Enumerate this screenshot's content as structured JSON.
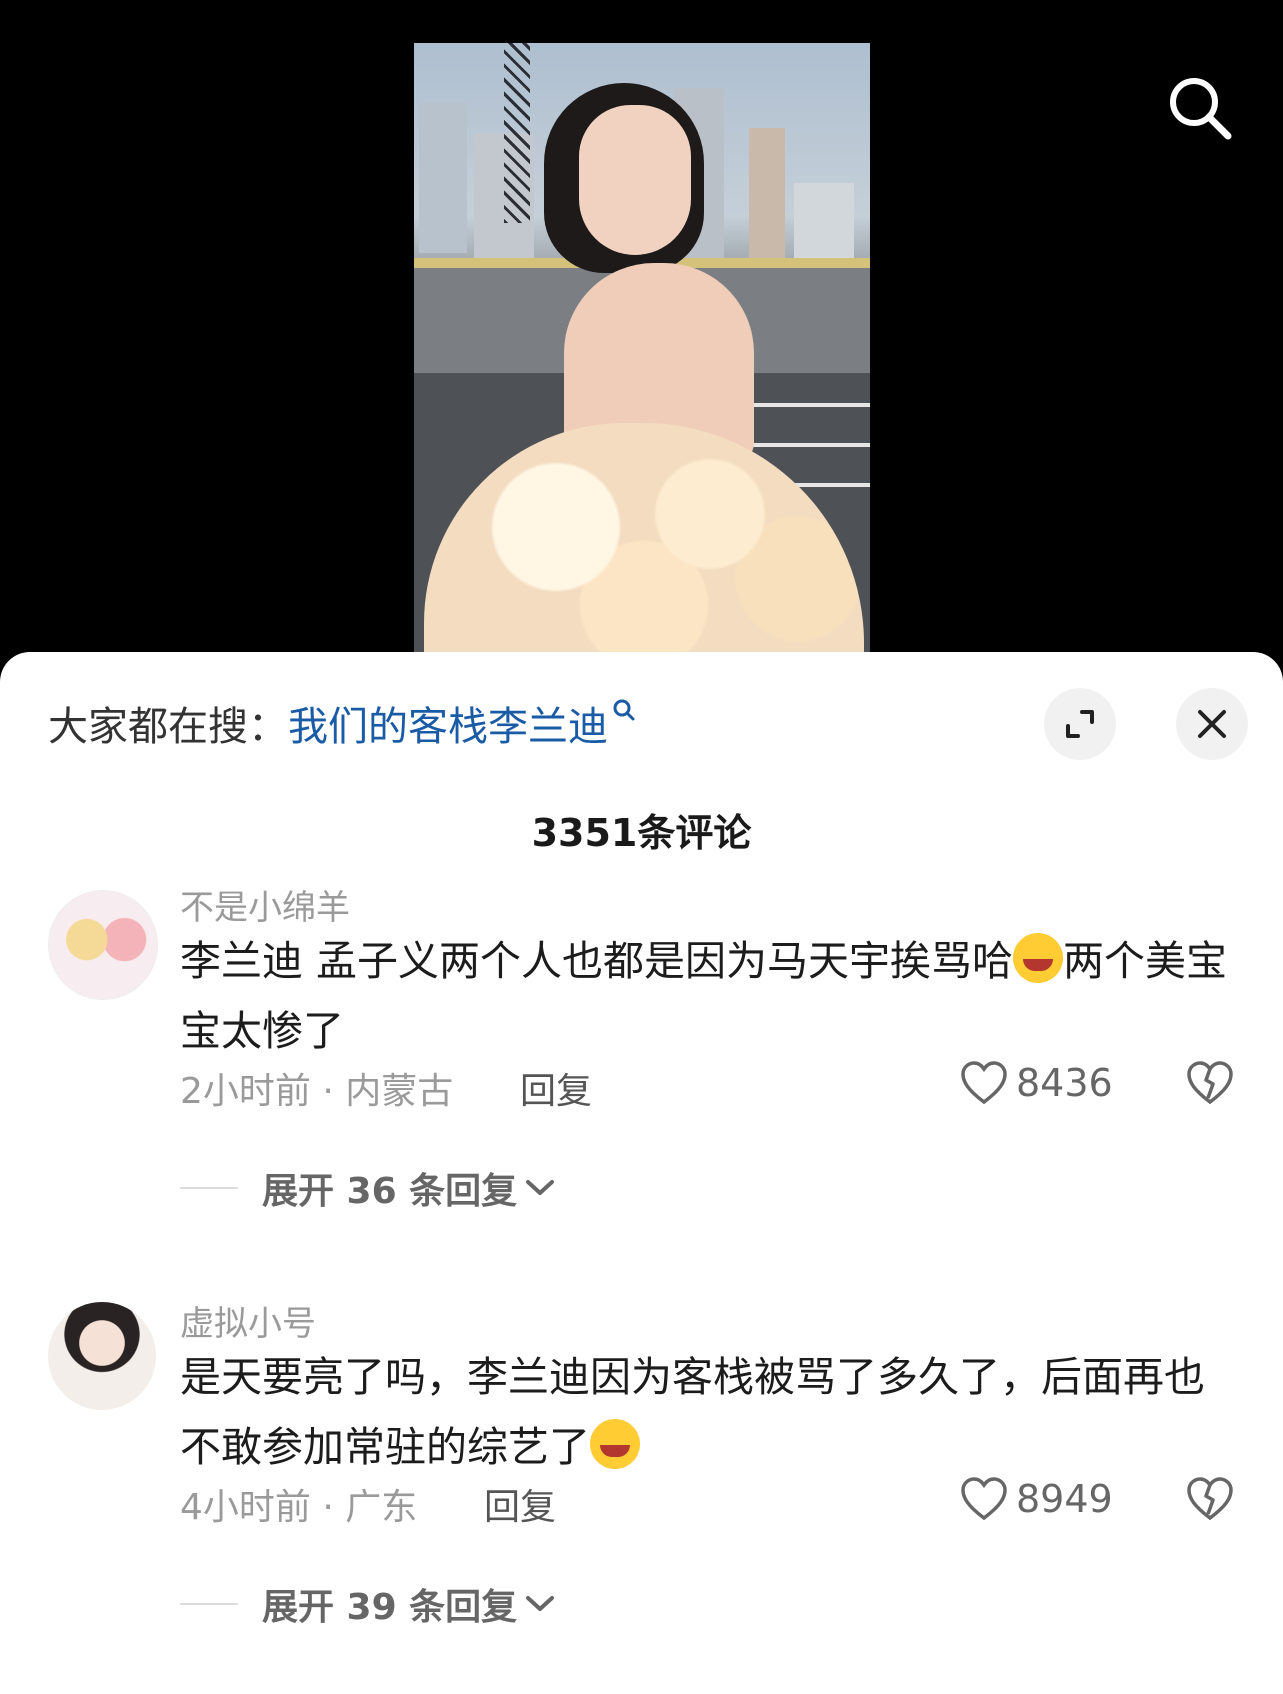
{
  "header": {
    "search_icon": "search-icon"
  },
  "trending": {
    "prefix": "大家都在搜：",
    "query": "我们的客栈李兰迪",
    "query_icon": "search-icon",
    "link_color": "#1a5ba6"
  },
  "controls": {
    "expand_icon": "expand-icon",
    "close_icon": "close-icon"
  },
  "comments_title": "3351条评论",
  "comments": [
    {
      "username": "不是小绵羊",
      "text_1": "李兰迪 孟子义两个人也都是因为马天宇挨骂哈",
      "text_2": "两个美宝宝太惨了",
      "emoji": "laughing-crying-emoji",
      "meta": "2小时前 · 内蒙古",
      "reply_label": "回复",
      "likes": "8436",
      "expand_label": "展开 36 条回复"
    },
    {
      "username": "虚拟小号",
      "text_1": "是天要亮了吗，李兰迪因为客栈被骂了多久了，后面再也不敢参加常驻的综艺了",
      "text_2": "",
      "emoji": "laughing-crying-emoji",
      "meta": "4小时前 · 广东",
      "reply_label": "回复",
      "likes": "8949",
      "expand_label": "展开 39 条回复"
    }
  ]
}
